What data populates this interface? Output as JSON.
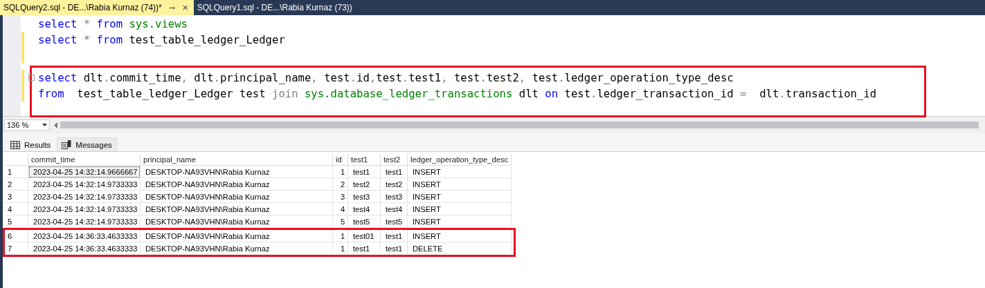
{
  "tabs": [
    {
      "label": "SQLQuery2.sql - DE...\\Rabia Kurnaz (74))*",
      "selected": true,
      "pin": "⊸",
      "close": "✕"
    },
    {
      "label": "SQLQuery1.sql - DE...\\Rabia Kurnaz (73))",
      "selected": false
    }
  ],
  "editor": {
    "lines": [
      {
        "changed": false,
        "highlighted": false,
        "collapsible": false,
        "tokens": [
          {
            "kind": "keyword",
            "text": "select"
          },
          {
            "kind": "operator",
            "text": " *"
          },
          {
            "kind": "keyword",
            "text": " from"
          },
          {
            "kind": "system",
            "text": " sys.views"
          }
        ]
      },
      {
        "changed": true,
        "highlighted": false,
        "collapsible": false,
        "tokens": [
          {
            "kind": "keyword",
            "text": "select"
          },
          {
            "kind": "operator",
            "text": " *"
          },
          {
            "kind": "keyword",
            "text": " from"
          },
          {
            "kind": "plain",
            "text": " test_table_ledger_Ledger"
          }
        ]
      },
      {
        "changed": true,
        "highlighted": false,
        "collapsible": false
      },
      {
        "changed": true,
        "highlighted": true,
        "collapsible": true,
        "tokens": [
          {
            "kind": "keyword",
            "text": "select"
          },
          {
            "kind": "plain",
            "text": " dlt"
          },
          {
            "kind": "operator",
            "text": "."
          },
          {
            "kind": "plain",
            "text": "commit_time"
          },
          {
            "kind": "operator",
            "text": ","
          },
          {
            "kind": "plain",
            "text": " dlt"
          },
          {
            "kind": "operator",
            "text": "."
          },
          {
            "kind": "plain",
            "text": "principal_name"
          },
          {
            "kind": "operator",
            "text": ","
          },
          {
            "kind": "plain",
            "text": " test"
          },
          {
            "kind": "operator",
            "text": "."
          },
          {
            "kind": "plain",
            "text": "id"
          },
          {
            "kind": "operator",
            "text": ","
          },
          {
            "kind": "plain",
            "text": "test"
          },
          {
            "kind": "operator",
            "text": "."
          },
          {
            "kind": "plain",
            "text": "test1"
          },
          {
            "kind": "operator",
            "text": ","
          },
          {
            "kind": "plain",
            "text": " test"
          },
          {
            "kind": "operator",
            "text": "."
          },
          {
            "kind": "plain",
            "text": "test2"
          },
          {
            "kind": "operator",
            "text": ","
          },
          {
            "kind": "plain",
            "text": " test"
          },
          {
            "kind": "operator",
            "text": "."
          },
          {
            "kind": "plain",
            "text": "ledger_operation_type_desc"
          }
        ]
      },
      {
        "changed": true,
        "highlighted": true,
        "collapsible": false,
        "tokens": [
          {
            "kind": "keyword",
            "text": "from"
          },
          {
            "kind": "plain",
            "text": "  test_table_ledger_Ledger test "
          },
          {
            "kind": "operator",
            "text": "join"
          },
          {
            "kind": "system",
            "text": " sys.database_ledger_transactions"
          },
          {
            "kind": "plain",
            "text": " dlt "
          },
          {
            "kind": "keyword",
            "text": "on"
          },
          {
            "kind": "plain",
            "text": " test"
          },
          {
            "kind": "operator",
            "text": "."
          },
          {
            "kind": "plain",
            "text": "ledger_transaction_id "
          },
          {
            "kind": "operator",
            "text": "="
          },
          {
            "kind": "plain",
            "text": "  dlt"
          },
          {
            "kind": "operator",
            "text": "."
          },
          {
            "kind": "plain",
            "text": "transaction_id"
          }
        ]
      }
    ]
  },
  "zoom": {
    "value": "136 %"
  },
  "result_tabs": [
    {
      "label": "Results",
      "selected": true
    },
    {
      "label": "Messages",
      "selected": false
    }
  ],
  "table": {
    "columns": [
      "",
      "commit_time",
      "principal_name",
      "id",
      "test1",
      "test2",
      "ledger_operation_type_desc"
    ],
    "rows": [
      {
        "highlighted": false,
        "focused": true,
        "cells": [
          "1",
          "2023-04-25 14:32:14.9666667",
          "DESKTOP-NA93VHN\\Rabia Kurnaz",
          "1",
          "test1",
          "test1",
          "INSERT"
        ]
      },
      {
        "highlighted": false,
        "focused": false,
        "cells": [
          "2",
          "2023-04-25 14:32:14.9733333",
          "DESKTOP-NA93VHN\\Rabia Kurnaz",
          "2",
          "test2",
          "test2",
          "INSERT"
        ]
      },
      {
        "highlighted": false,
        "focused": false,
        "cells": [
          "3",
          "2023-04-25 14:32:14.9733333",
          "DESKTOP-NA93VHN\\Rabia Kurnaz",
          "3",
          "test3",
          "test3",
          "INSERT"
        ]
      },
      {
        "highlighted": false,
        "focused": false,
        "cells": [
          "4",
          "2023-04-25 14:32:14.9733333",
          "DESKTOP-NA93VHN\\Rabia Kurnaz",
          "4",
          "test4",
          "test4",
          "INSERT"
        ]
      },
      {
        "highlighted": false,
        "focused": false,
        "cells": [
          "5",
          "2023-04-25 14:32:14.9733333",
          "DESKTOP-NA93VHN\\Rabia Kurnaz",
          "5",
          "test5",
          "test5",
          "INSERT"
        ]
      },
      {
        "highlighted": true,
        "focused": false,
        "cells": [
          "6",
          "2023-04-25 14:36:33.4633333",
          "DESKTOP-NA93VHN\\Rabia Kurnaz",
          "1",
          "test01",
          "test1",
          "INSERT"
        ]
      },
      {
        "highlighted": true,
        "focused": false,
        "cells": [
          "7",
          "2023-04-25 14:36:33.4633333",
          "DESKTOP-NA93VHN\\Rabia Kurnaz",
          "1",
          "test1",
          "test1",
          "DELETE"
        ]
      }
    ]
  }
}
